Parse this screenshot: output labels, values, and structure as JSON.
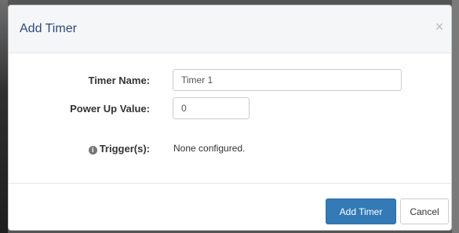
{
  "modal": {
    "title": "Add Timer",
    "close_glyph": "×",
    "fields": {
      "timer_name": {
        "label": "Timer Name:",
        "value": "Timer 1"
      },
      "power_up_value": {
        "label": "Power Up Value:",
        "value": "0"
      },
      "triggers": {
        "label": "Trigger(s):",
        "icon": "info-icon",
        "info_glyph": "i",
        "value": "None configured."
      }
    },
    "footer": {
      "primary_label": "Add Timer",
      "cancel_label": "Cancel"
    }
  },
  "colors": {
    "primary": "#337ab7",
    "title": "#2d4a7a"
  }
}
